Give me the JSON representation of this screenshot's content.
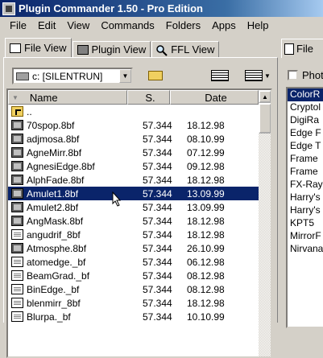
{
  "window": {
    "title": "Plugin Commander 1.50 - Pro Edition"
  },
  "menu": [
    "File",
    "Edit",
    "View",
    "Commands",
    "Folders",
    "Apps",
    "Help"
  ],
  "tabs": [
    {
      "label": "File View",
      "icon": "file-view-icon",
      "active": true
    },
    {
      "label": "Plugin View",
      "icon": "plugin-view-icon",
      "active": false
    },
    {
      "label": "FFL View",
      "icon": "magnifier-icon",
      "active": false
    }
  ],
  "drive": {
    "value": "c: [SILENTRUN]"
  },
  "columns": [
    "Name",
    "S.",
    "Date"
  ],
  "files": [
    {
      "name": "..",
      "size": "",
      "date": "",
      "icon": "parent-folder"
    },
    {
      "name": "70spop.8bf",
      "size": "57.344",
      "date": "18.12.98"
    },
    {
      "name": "adjmosa.8bf",
      "size": "57.344",
      "date": "08.10.99"
    },
    {
      "name": "AgneMirr.8bf",
      "size": "57.344",
      "date": "07.12.99"
    },
    {
      "name": "AgnesiEdge.8bf",
      "size": "57.344",
      "date": "09.12.98"
    },
    {
      "name": "AlphFade.8bf",
      "size": "57.344",
      "date": "18.12.98"
    },
    {
      "name": "Amulet1.8bf",
      "size": "57.344",
      "date": "13.09.99",
      "selected": true
    },
    {
      "name": "Amulet2.8bf",
      "size": "57.344",
      "date": "13.09.99"
    },
    {
      "name": "AngMask.8bf",
      "size": "57.344",
      "date": "18.12.98"
    },
    {
      "name": "angudrif_8bf",
      "size": "57.344",
      "date": "18.12.98",
      "icon": "file"
    },
    {
      "name": "Atmosphe.8bf",
      "size": "57.344",
      "date": "26.10.99"
    },
    {
      "name": "atomedge._bf",
      "size": "57.344",
      "date": "06.12.98",
      "icon": "file"
    },
    {
      "name": "BeamGrad._bf",
      "size": "57.344",
      "date": "08.12.98",
      "icon": "file"
    },
    {
      "name": "BinEdge._bf",
      "size": "57.344",
      "date": "08.12.98",
      "icon": "file"
    },
    {
      "name": "blenmirr_8bf",
      "size": "57.344",
      "date": "18.12.98",
      "icon": "file"
    },
    {
      "name": "Blurpa._bf",
      "size": "57.344",
      "date": "10.10.99",
      "icon": "file"
    }
  ],
  "right_pane": {
    "tab_label": "File",
    "checkbox_label": "Phot",
    "items": [
      "ColorR",
      "Cryptol",
      "DigiRa",
      "Edge F",
      "Edge T",
      "Frame",
      "Frame",
      "FX-Ray",
      "Harry's",
      "Harry's",
      "KPT5",
      "MirrorF",
      "Nirvana"
    ]
  }
}
